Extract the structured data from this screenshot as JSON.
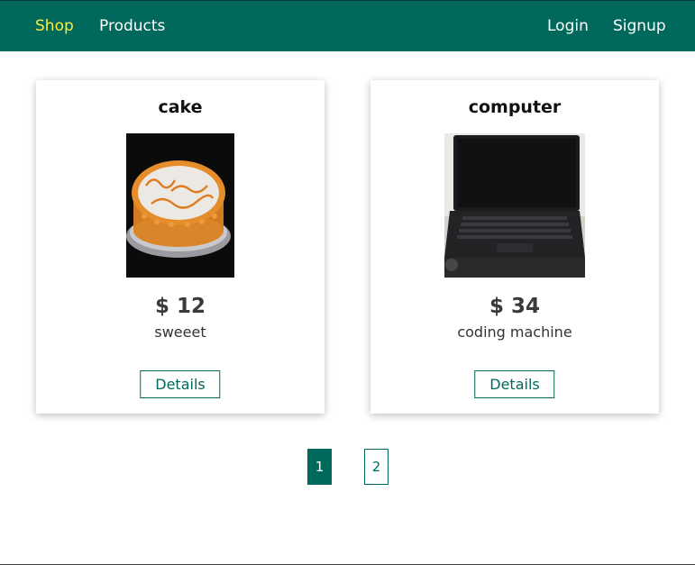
{
  "header": {
    "nav_left": [
      {
        "label": "Shop",
        "active": true
      },
      {
        "label": "Products",
        "active": false
      }
    ],
    "nav_right": [
      {
        "label": "Login"
      },
      {
        "label": "Signup"
      }
    ],
    "background_color": "#00695c",
    "active_color": "#ffeb3b"
  },
  "products": [
    {
      "title": "cake",
      "price": "$ 12",
      "description": "sweeet",
      "image_icon": "cake-photo",
      "button_label": "Details"
    },
    {
      "title": "computer",
      "price": "$ 34",
      "description": "coding machine",
      "image_icon": "laptop-photo",
      "button_label": "Details"
    }
  ],
  "pagination": {
    "pages": [
      "1",
      "2"
    ],
    "current": "1"
  }
}
